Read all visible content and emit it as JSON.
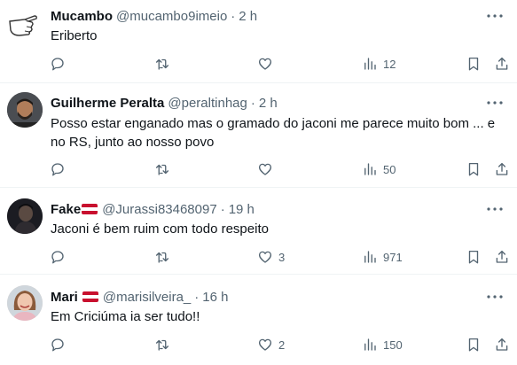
{
  "tweets": [
    {
      "name": "Mucambo",
      "handle": "@mucambo9imeio",
      "time": "2 h",
      "has_flag": false,
      "text": "Eriberto",
      "replies": "",
      "retweets": "",
      "likes": "",
      "views": "12",
      "avatar": "hand-pointing-drawing"
    },
    {
      "name": "Guilherme Peralta",
      "handle": "@peraltinhag",
      "time": "2 h",
      "has_flag": false,
      "text": "Posso estar enganado mas o gramado do jaconi me parece muito bom ... e no RS, junto ao nosso povo",
      "replies": "",
      "retweets": "",
      "likes": "",
      "views": "50",
      "avatar": "man-beard-photo"
    },
    {
      "name": "Fake",
      "handle": "@Jurassi83468097",
      "time": "19 h",
      "has_flag": true,
      "text": "Jaconi é bem ruim com todo respeito",
      "replies": "",
      "retweets": "",
      "likes": "3",
      "views": "971",
      "avatar": "dark-figure-photo"
    },
    {
      "name": "Mari",
      "handle": "@marisilveira_",
      "time": "16 h",
      "has_flag": true,
      "text": "Em Criciúma ia ser tudo!!",
      "replies": "",
      "retweets": "",
      "likes": "2",
      "views": "150",
      "avatar": "woman-smiling-photo"
    }
  ],
  "colors": {
    "text": "#0f1419",
    "secondary": "#536471",
    "divider": "#eff3f4",
    "flag_red": "#c8102e"
  },
  "separator": "·",
  "icons": [
    "reply-icon",
    "retweet-icon",
    "like-icon",
    "views-icon",
    "bookmark-icon",
    "share-icon",
    "more-icon"
  ]
}
